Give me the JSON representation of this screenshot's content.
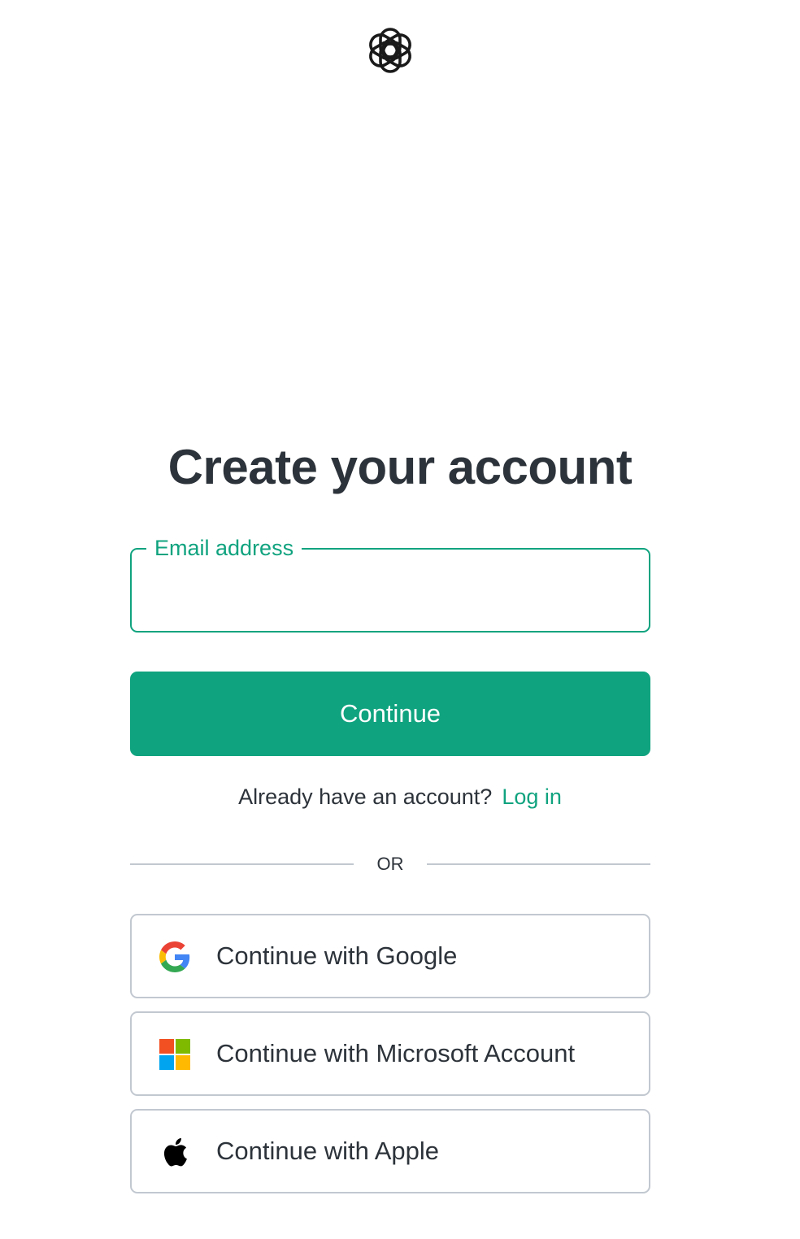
{
  "header": {
    "logo_icon": "openai-logo-icon"
  },
  "main": {
    "title": "Create your account",
    "email": {
      "label": "Email address",
      "value": "",
      "placeholder": ""
    },
    "continue_label": "Continue",
    "login_prompt": "Already have an account?",
    "login_link": "Log in",
    "divider_text": "OR",
    "social": [
      {
        "label": "Continue with Google",
        "icon": "google-icon"
      },
      {
        "label": "Continue with Microsoft Account",
        "icon": "microsoft-icon"
      },
      {
        "label": "Continue with Apple",
        "icon": "apple-icon"
      }
    ]
  },
  "colors": {
    "accent": "#10a37f",
    "text": "#2d333a",
    "border": "#c2c8d0",
    "microsoft": [
      "#f25022",
      "#7fba00",
      "#00a4ef",
      "#ffb900"
    ]
  }
}
